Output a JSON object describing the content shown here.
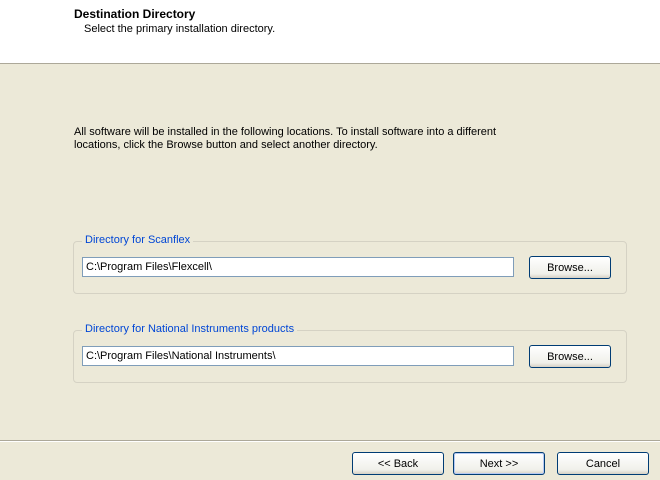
{
  "header": {
    "title": "Destination Directory",
    "subtitle": "Select the primary installation directory."
  },
  "description": "All software will be installed in the following locations. To install software into a different locations, click the Browse button and select another directory.",
  "groups": [
    {
      "label": "Directory for Scanflex",
      "path": "C:\\Program Files\\Flexcell\\",
      "browse_label": "Browse..."
    },
    {
      "label": "Directory for National Instruments products",
      "path": "C:\\Program Files\\National Instruments\\",
      "browse_label": "Browse..."
    }
  ],
  "footer": {
    "back_label": "<< Back",
    "next_label": "Next >>",
    "cancel_label": "Cancel"
  },
  "colors": {
    "dialog_bg": "#ece9d8",
    "header_bg": "#ffffff",
    "group_label": "#0046d5",
    "input_border": "#7f9db9"
  }
}
